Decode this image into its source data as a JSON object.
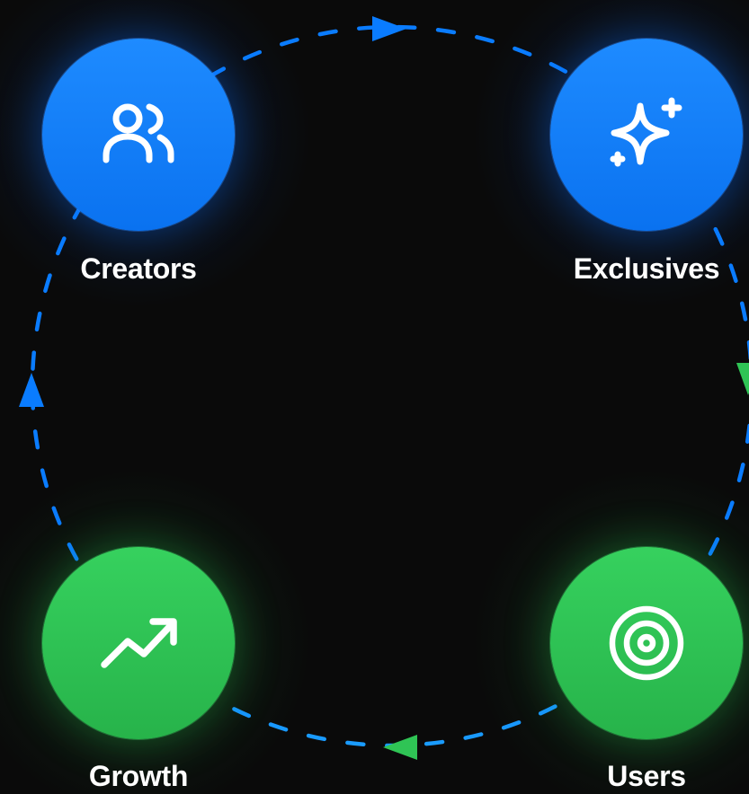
{
  "colors": {
    "background": "#0a0a0a",
    "blue": "#0a7cff",
    "green": "#2fc455",
    "label": "#ffffff"
  },
  "nodes": [
    {
      "id": "creators",
      "label": "Creators",
      "icon": "users-icon",
      "color": "blue"
    },
    {
      "id": "exclusives",
      "label": "Exclusives",
      "icon": "sparkles-icon",
      "color": "blue"
    },
    {
      "id": "users",
      "label": "Users",
      "icon": "target-icon",
      "color": "green"
    },
    {
      "id": "growth",
      "label": "Growth",
      "icon": "trending-up-icon",
      "color": "green"
    }
  ],
  "flow": [
    "creators",
    "exclusives",
    "users",
    "growth",
    "creators"
  ]
}
